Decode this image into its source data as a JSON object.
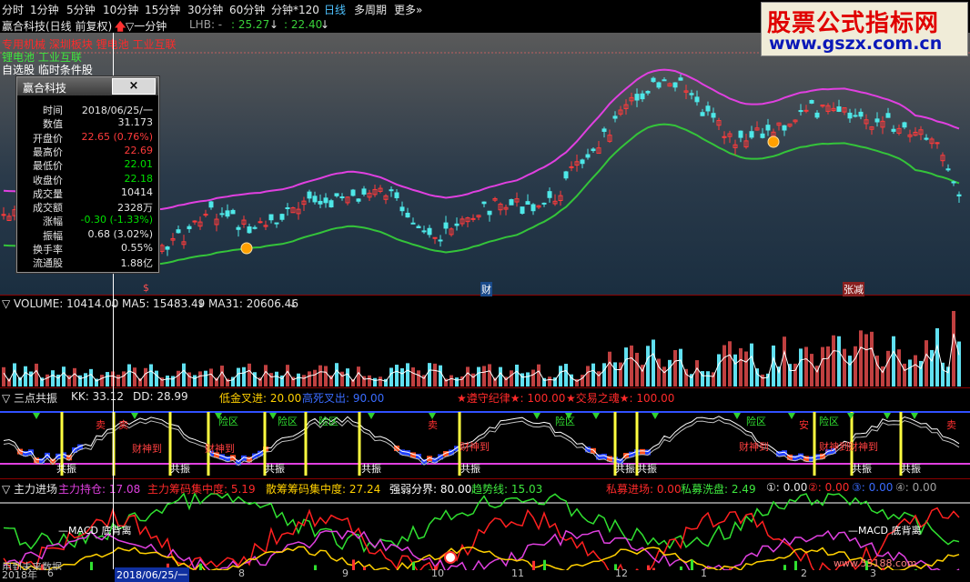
{
  "menu": {
    "tabs": [
      "分时",
      "1分钟",
      "5分钟",
      "10分钟",
      "15分钟",
      "30分钟",
      "60分钟",
      "分钟*120",
      "日线",
      "多周期",
      "更多»"
    ],
    "active": "日线"
  },
  "logo": {
    "title": "股票公式指标网",
    "url": "www.gszx.com.cn"
  },
  "title_line": {
    "stock": "赢合科技(日线 前复权)",
    "indicator": "▽一分钟",
    "lhb_label": "LHB: -",
    "lhb_v1": ": 25.27",
    "lhb_v2": ": 22.40"
  },
  "concepts": {
    "line1": "专用机械 深圳板块 锂电池 工业互联",
    "line2": "锂电池 工业互联",
    "line3": "自选股 临时条件股"
  },
  "infobox": {
    "title": "赢合科技",
    "close": "×",
    "rows": [
      {
        "k": "时间",
        "v": "2018/06/25/一",
        "c": "#e6e6e6"
      },
      {
        "k": "数值",
        "v": "31.173",
        "c": "#e6e6e6"
      },
      {
        "k": "开盘价",
        "v": "22.65 (0.76%)",
        "c": "#ff3b3b"
      },
      {
        "k": "最高价",
        "v": "22.69",
        "c": "#ff3b3b"
      },
      {
        "k": "最低价",
        "v": "22.01",
        "c": "#00e000"
      },
      {
        "k": "收盘价",
        "v": "22.18",
        "c": "#00e000"
      },
      {
        "k": "成交量",
        "v": "10414",
        "c": "#e6e6e6"
      },
      {
        "k": "成交额",
        "v": "2328万",
        "c": "#e6e6e6"
      },
      {
        "k": "涨幅",
        "v": "-0.30 (-1.33%)",
        "c": "#00e000"
      },
      {
        "k": "振幅",
        "v": "0.68 (3.02%)",
        "c": "#e6e6e6"
      },
      {
        "k": "换手率",
        "v": "0.55%",
        "c": "#e6e6e6"
      },
      {
        "k": "流通股",
        "v": "1.88亿",
        "c": "#e6e6e6"
      }
    ]
  },
  "price_markers": {
    "s": "$",
    "cai": "财",
    "zhangjian": "张减"
  },
  "volume": {
    "label": "▽ VOLUME: 10414.00",
    "ma5": "MA5: 15483.49",
    "ma31": "MA31: 20606.46"
  },
  "sandian": {
    "label": "▽ 三点共振",
    "kk": "KK: 33.12",
    "dd": "DD: 28.99",
    "dijin": "低金叉进: 20.00",
    "gaosi": "高死叉出: 90.00",
    "zunshou": "★遵守纪律★: 100.00",
    "jiaoyi": "★交易之魂★: 100.00",
    "words": {
      "gongzhen": "共振",
      "caishen": "财神到",
      "xianqu": "险区",
      "mai": "卖",
      "an": "安"
    }
  },
  "zhuli": {
    "label": "▽ 主力进场",
    "chicang": "主力持仓: 17.08",
    "choumajizhong": "主力筹码集中度: 5.19",
    "sanhu": "散筹筹码集中度: 27.24",
    "qiangruo": "强弱分界: 80.00",
    "qushi": "趋势线: 15.03",
    "simujin": "私募进场: 0.00",
    "simuxipan": "私募洗盘: 2.49",
    "c1": "①: 0.00",
    "c2": "②: 0.00",
    "c3": "③: 0.00",
    "c4": "④: 0.00",
    "macd1": "—MACD 底背离",
    "macd2": "—MACD 底背离",
    "bottom_text": "用到未来数据"
  },
  "dates": {
    "d0": "2018年",
    "d1": "6",
    "cursor_date": "2018/06/25/一",
    "d2": "8",
    "d3": "9",
    "d4": "10",
    "d5": "11",
    "d6": "12",
    "d7": "1",
    "d8": "2",
    "d9": "3"
  },
  "watermark": "www.55188.com",
  "colors": {
    "up": "#ff3b3b",
    "down": "#4ee8e8",
    "green_band": "#34c43a",
    "magenta_band": "#e040e0"
  }
}
